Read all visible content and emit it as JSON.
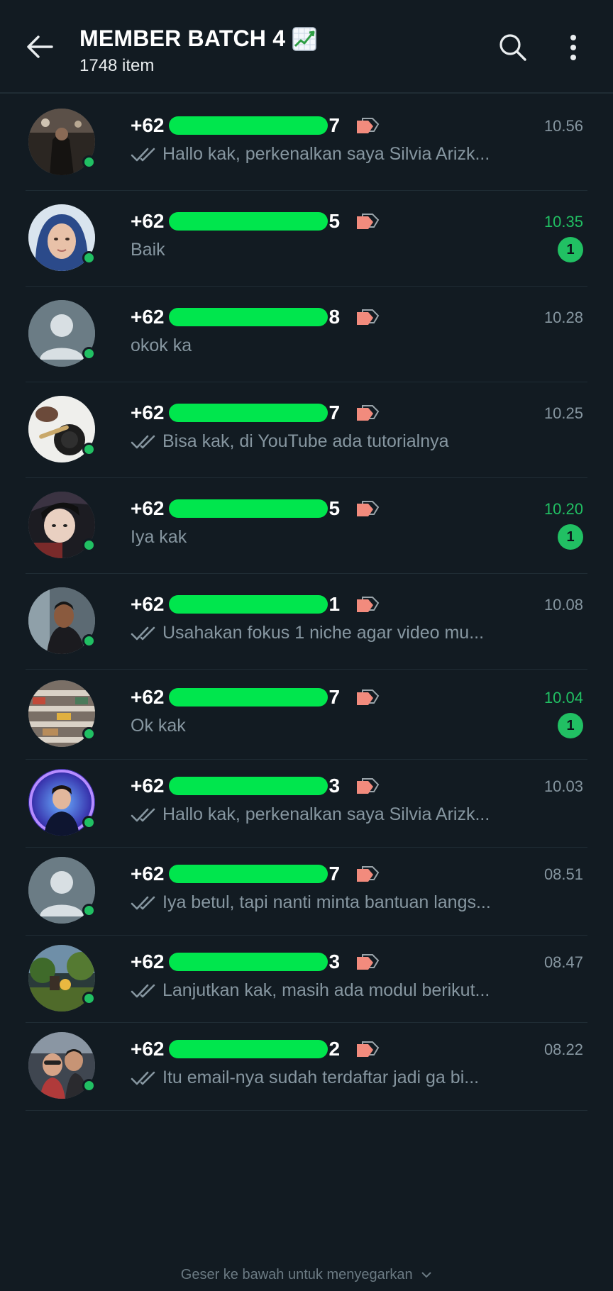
{
  "header": {
    "title": "MEMBER BATCH 4",
    "title_emoji": "chart-increasing-icon",
    "subtitle": "1748 item"
  },
  "chats": [
    {
      "prefix": "+62",
      "suffix": "7",
      "time": "10.56",
      "unread": false,
      "ticks": true,
      "preview": "Hallo kak, perkenalkan saya Silvia Arizk...",
      "avatar": "photo-dark"
    },
    {
      "prefix": "+62",
      "suffix": "5",
      "time": "10.35",
      "unread": true,
      "badge": "1",
      "ticks": false,
      "preview": "Baik",
      "avatar": "photo-hijab"
    },
    {
      "prefix": "+62",
      "suffix": "8",
      "time": "10.28",
      "unread": false,
      "ticks": false,
      "preview": "okok ka",
      "avatar": "default"
    },
    {
      "prefix": "+62",
      "suffix": "7",
      "time": "10.25",
      "unread": false,
      "ticks": true,
      "preview": "Bisa kak, di YouTube ada tutorialnya",
      "avatar": "photo-products"
    },
    {
      "prefix": "+62",
      "suffix": "5",
      "time": "10.20",
      "unread": true,
      "badge": "1",
      "ticks": false,
      "preview": "Iya kak",
      "avatar": "photo-selfie"
    },
    {
      "prefix": "+62",
      "suffix": "1",
      "time": "10.08",
      "unread": false,
      "ticks": true,
      "preview": "Usahakan fokus 1 niche agar video mu...",
      "avatar": "photo-man"
    },
    {
      "prefix": "+62",
      "suffix": "7",
      "time": "10.04",
      "unread": true,
      "badge": "1",
      "ticks": false,
      "preview": "Ok kak",
      "avatar": "photo-shelves"
    },
    {
      "prefix": "+62",
      "suffix": "3",
      "time": "10.03",
      "unread": false,
      "ticks": true,
      "preview": "Hallo kak, perkenalkan saya Silvia Arizk...",
      "avatar": "photo-blue"
    },
    {
      "prefix": "+62",
      "suffix": "7",
      "time": "08.51",
      "unread": false,
      "ticks": true,
      "preview": "Iya betul, tapi nanti minta bantuan langs...",
      "avatar": "default"
    },
    {
      "prefix": "+62",
      "suffix": "3",
      "time": "08.47",
      "unread": false,
      "ticks": true,
      "preview": "Lanjutkan kak, masih ada modul berikut...",
      "avatar": "photo-garden"
    },
    {
      "prefix": "+62",
      "suffix": "2",
      "time": "08.22",
      "unread": false,
      "ticks": true,
      "preview": "Itu email-nya sudah terdaftar jadi ga bi...",
      "avatar": "photo-couple"
    }
  ],
  "footer": {
    "hint": "Geser ke bawah untuk menyegarkan"
  },
  "colors": {
    "background": "#121b22",
    "accent_green": "#21c063",
    "redaction": "#00e64d",
    "tag": "#f28b7d",
    "muted_text": "#8696a0"
  }
}
